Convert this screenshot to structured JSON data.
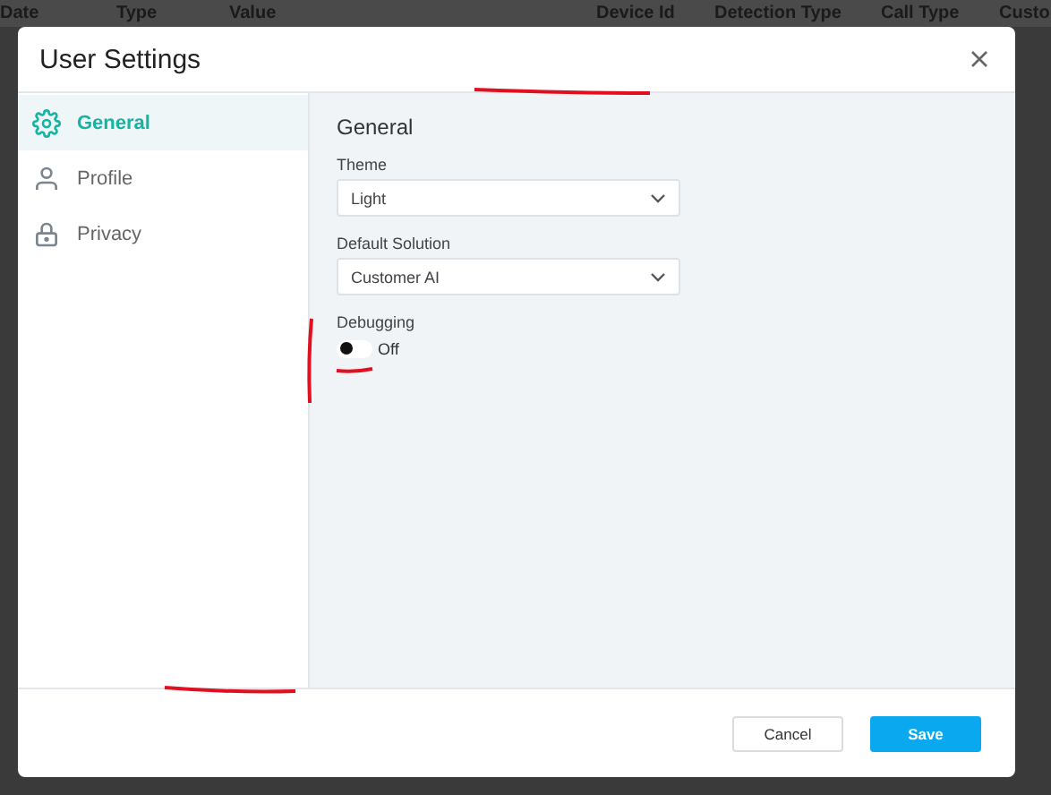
{
  "background_table": {
    "columns": [
      "Date",
      "Type",
      "Value",
      "Device Id",
      "Detection Type",
      "Call Type",
      "Custo"
    ]
  },
  "dialog": {
    "title": "User Settings"
  },
  "sidebar": {
    "items": [
      {
        "label": "General",
        "selected": true
      },
      {
        "label": "Profile",
        "selected": false
      },
      {
        "label": "Privacy",
        "selected": false
      }
    ]
  },
  "panel": {
    "heading": "General",
    "fields": [
      {
        "kind": "select",
        "label": "Theme",
        "value": "Light"
      },
      {
        "kind": "select",
        "label": "Default Solution",
        "value": "Customer AI"
      },
      {
        "kind": "toggle",
        "label": "Debugging",
        "on": false,
        "state_text": "Off"
      }
    ]
  },
  "buttons": [
    {
      "label": "Cancel",
      "kind": "secondary"
    },
    {
      "label": "Save",
      "kind": "primary"
    }
  ]
}
